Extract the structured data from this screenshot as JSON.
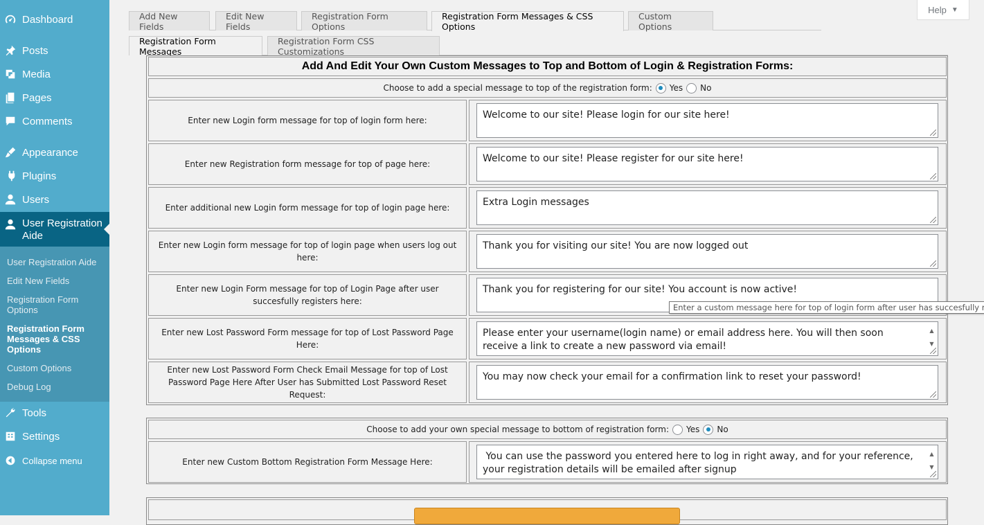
{
  "sidebar": {
    "menu": [
      {
        "label": "Dashboard",
        "icon": "dashboard-icon"
      },
      {
        "label": "Posts",
        "icon": "pin-icon"
      },
      {
        "label": "Media",
        "icon": "media-icon"
      },
      {
        "label": "Pages",
        "icon": "pages-icon"
      },
      {
        "label": "Comments",
        "icon": "comment-icon"
      },
      {
        "label": "Appearance",
        "icon": "brush-icon"
      },
      {
        "label": "Plugins",
        "icon": "plug-icon"
      },
      {
        "label": "Users",
        "icon": "user-icon"
      },
      {
        "label": "User Registration Aide",
        "icon": "user-icon"
      },
      {
        "label": "Tools",
        "icon": "wrench-icon"
      },
      {
        "label": "Settings",
        "icon": "settings-icon"
      },
      {
        "label": "Collapse menu",
        "icon": "collapse-icon"
      }
    ],
    "submenu": [
      {
        "label": "User Registration Aide"
      },
      {
        "label": "Edit New Fields"
      },
      {
        "label": "Registration Form Options"
      },
      {
        "label": "Registration Form Messages & CSS Options"
      },
      {
        "label": "Custom Options"
      },
      {
        "label": "Debug Log"
      }
    ]
  },
  "help": {
    "label": "Help"
  },
  "tabs": {
    "main": [
      {
        "label": "Add New Fields"
      },
      {
        "label": "Edit New Fields"
      },
      {
        "label": "Registration Form Options"
      },
      {
        "label": "Registration Form Messages & CSS Options"
      },
      {
        "label": "Custom Options"
      }
    ],
    "sub": [
      {
        "label": "Registration Form Messages"
      },
      {
        "label": "Registration Form CSS Customizations"
      }
    ]
  },
  "top_panel": {
    "heading": "Add And Edit Your Own Custom Messages to Top and Bottom of Login & Registration Forms:",
    "choose_label": "Choose to add a special message to top of the registration form:",
    "yes_label": "Yes",
    "no_label": "No",
    "selected": "Yes",
    "rows": [
      {
        "label": "Enter new Login form message for top of login form here:",
        "value": "Welcome to our site! Please login for our site here!"
      },
      {
        "label": "Enter new Registration form message for top of page here:",
        "value": "Welcome to our site! Please register for our site here!"
      },
      {
        "label": "Enter additional new Login form message for top of login page here:",
        "value": "Extra Login messages"
      },
      {
        "label": "Enter new Login form message for top of login page when users log out here:",
        "value": "Thank you for visiting our site! You are now logged out"
      },
      {
        "label": "Enter new Login Form message for top of Login Page after user succesfully registers here:",
        "value": "Thank you for registering for our site! You account is now active!"
      },
      {
        "label": "Enter new Lost Password Form message for top of Lost Password Page Here:",
        "value": "Please enter your username(login name) or email address here. You will then soon receive a link to create a new password via email!"
      },
      {
        "label": "Enter new Lost Password Form Check Email Message for top of Lost Password Page Here After User has Submitted Lost Password Reset Request:",
        "value": "You may now check your email for a confirmation link to reset your password!"
      }
    ]
  },
  "bottom_panel": {
    "choose_label": "Choose to add your own special message to bottom of registration form:",
    "yes_label": "Yes",
    "no_label": "No",
    "selected": "No",
    "row": {
      "label": "Enter new Custom Bottom Registration Form Message Here:",
      "value": " You can use the password you entered here to log in right away, and for your reference, your registration details will be emailed after signup"
    }
  },
  "tooltip": "Enter a custom message here for top of login form after user has succesfully registered",
  "colors": {
    "sidebar": "#52accc",
    "sidebar_active": "#096484",
    "submenu": "#4796b3",
    "button": "#f0a93b"
  }
}
